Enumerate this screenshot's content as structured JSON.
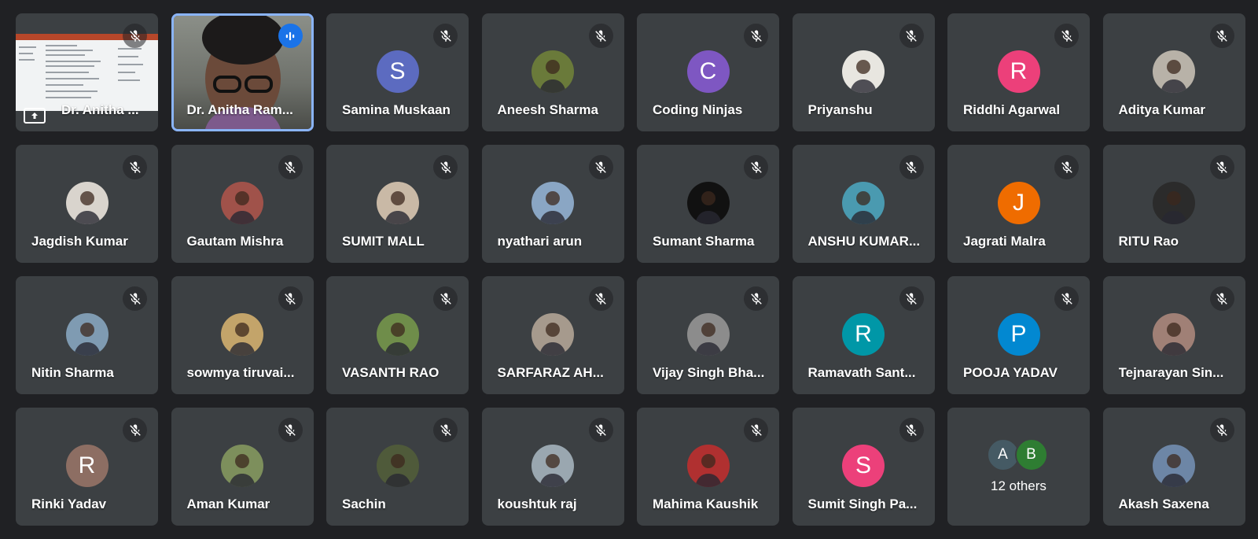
{
  "participants": [
    {
      "name": "Dr. Anitha ...",
      "type": "presentation",
      "mic": "muted"
    },
    {
      "name": "Dr. Anitha Ram...",
      "type": "video",
      "mic": "speaking"
    },
    {
      "name": "Samina Muskaan",
      "type": "initial",
      "initial": "S",
      "color": "#5c6bc0",
      "mic": "muted"
    },
    {
      "name": "Aneesh Sharma",
      "type": "photo",
      "photo": "#6a7a3a",
      "mic": "muted"
    },
    {
      "name": "Coding Ninjas",
      "type": "initial",
      "initial": "C",
      "color": "#7e57c2",
      "mic": "muted"
    },
    {
      "name": "Priyanshu",
      "type": "photo",
      "photo": "#e8e6e0",
      "mic": "muted"
    },
    {
      "name": "Riddhi Agarwal",
      "type": "initial",
      "initial": "R",
      "color": "#ec407a",
      "mic": "muted"
    },
    {
      "name": "Aditya Kumar",
      "type": "photo",
      "photo": "#b8b2a8",
      "mic": "muted"
    },
    {
      "name": "Jagdish Kumar",
      "type": "photo",
      "photo": "#d9d4cd",
      "mic": "muted"
    },
    {
      "name": "Gautam Mishra",
      "type": "photo",
      "photo": "#a0524a",
      "mic": "muted"
    },
    {
      "name": "SUMIT MALL",
      "type": "photo",
      "photo": "#c9b9a6",
      "mic": "muted"
    },
    {
      "name": "nyathari arun",
      "type": "photo",
      "photo": "#8aa6c4",
      "mic": "muted"
    },
    {
      "name": "Sumant Sharma",
      "type": "photo",
      "photo": "#111111",
      "mic": "muted"
    },
    {
      "name": "ANSHU KUMAR...",
      "type": "photo",
      "photo": "#4a9ab0",
      "mic": "muted"
    },
    {
      "name": "Jagrati Malra",
      "type": "initial",
      "initial": "J",
      "color": "#ef6c00",
      "mic": "muted"
    },
    {
      "name": "RITU Rao",
      "type": "photo",
      "photo": "#2b2b2b",
      "mic": "muted"
    },
    {
      "name": "Nitin Sharma",
      "type": "photo",
      "photo": "#7f9bb2",
      "mic": "muted"
    },
    {
      "name": "sowmya tiruvai...",
      "type": "photo",
      "photo": "#c3a46a",
      "mic": "muted"
    },
    {
      "name": "VASANTH RAO",
      "type": "photo",
      "photo": "#6f8d4a",
      "mic": "muted"
    },
    {
      "name": "SARFARAZ AH...",
      "type": "photo",
      "photo": "#a69a8d",
      "mic": "muted"
    },
    {
      "name": "Vijay Singh Bha...",
      "type": "photo",
      "photo": "#8c8c8c",
      "mic": "muted"
    },
    {
      "name": "Ramavath Sant...",
      "type": "initial",
      "initial": "R",
      "color": "#0097a7",
      "mic": "muted"
    },
    {
      "name": "POOJA YADAV",
      "type": "initial",
      "initial": "P",
      "color": "#0288d1",
      "mic": "muted"
    },
    {
      "name": "Tejnarayan Sin...",
      "type": "photo",
      "photo": "#a08076",
      "mic": "muted"
    },
    {
      "name": "Rinki Yadav",
      "type": "initial",
      "initial": "R",
      "color": "#8d6e63",
      "mic": "muted"
    },
    {
      "name": "Aman Kumar",
      "type": "photo",
      "photo": "#7d8f5c",
      "mic": "muted"
    },
    {
      "name": "Sachin",
      "type": "photo",
      "photo": "#4f5a3a",
      "mic": "muted"
    },
    {
      "name": "koushtuk raj",
      "type": "photo",
      "photo": "#9aa7b0",
      "mic": "muted"
    },
    {
      "name": "Mahima Kaushik",
      "type": "photo",
      "photo": "#b03030",
      "mic": "muted"
    },
    {
      "name": "Sumit Singh Pa...",
      "type": "initial",
      "initial": "S",
      "color": "#ec407a",
      "mic": "muted"
    },
    {
      "name": "12 others",
      "type": "others",
      "avatars": [
        {
          "initial": "A",
          "color": "#455a64"
        },
        {
          "initial": "B",
          "color": "#2e7d32"
        }
      ]
    },
    {
      "name": "Akash Saxena",
      "type": "photo",
      "photo": "#6d86a6",
      "mic": "muted"
    }
  ],
  "icons": {
    "muted": "mic-off-icon",
    "speaking": "audio-level-icon",
    "present": "present-to-all-icon"
  }
}
